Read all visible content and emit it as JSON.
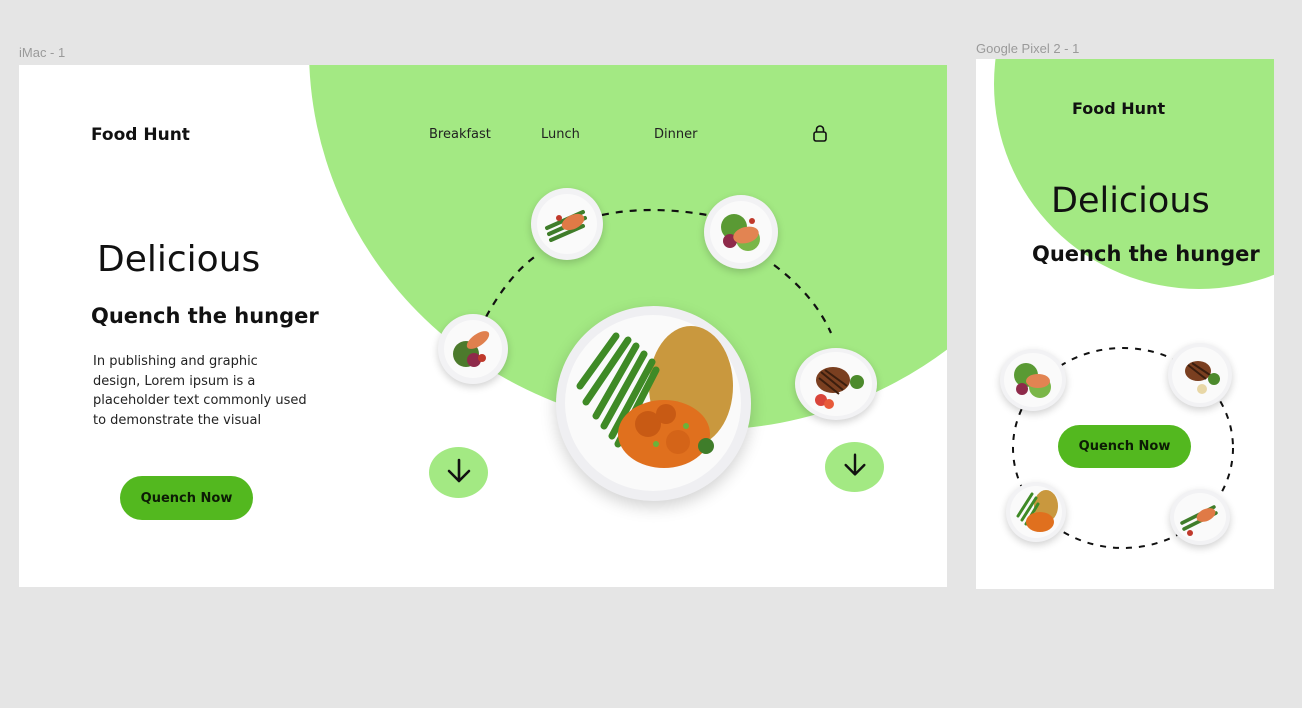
{
  "canvas": {
    "frames": [
      {
        "id": "desktop",
        "label": "iMac - 1"
      },
      {
        "id": "mobile",
        "label": "Google Pixel 2 - 1"
      }
    ]
  },
  "desktop": {
    "logo": "Food Hunt",
    "nav": [
      "Breakfast",
      "Lunch",
      "Dinner"
    ],
    "nav_icon": "lock-icon",
    "headline": "Delicious",
    "subheadline": "Quench the hunger",
    "body": "In publishing and graphic\ndesign, Lorem ipsum is a\nplaceholder text commonly used\nto demonstrate the visual",
    "cta": "Quench Now",
    "scroll_icon": "arrow-down-icon",
    "dishes": [
      "salmon-asparagus-plate",
      "salmon-salad-plate",
      "salmon-veggie-plate",
      "steak-plate",
      "chicken-rice-beans-plate"
    ]
  },
  "mobile": {
    "logo": "Food Hunt",
    "headline": "Delicious",
    "subheadline": "Quench the hunger",
    "cta": "Quench Now",
    "dishes": [
      "salmon-salad-plate",
      "steak-plate",
      "chicken-rice-beans-plate",
      "salmon-asparagus-plate"
    ]
  },
  "colors": {
    "accent_light": "#a3e983",
    "accent_dark": "#53b81f",
    "canvas_bg": "#e5e5e5"
  }
}
